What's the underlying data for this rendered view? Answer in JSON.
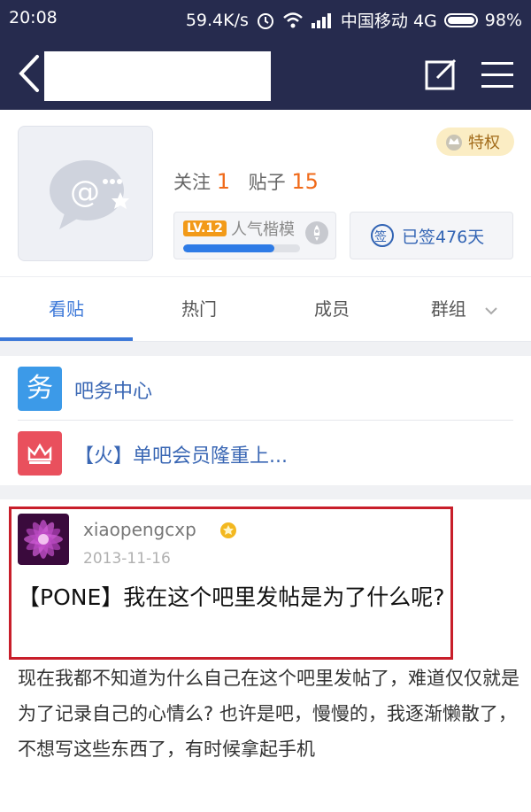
{
  "status_bar": {
    "time": "20:08",
    "network_speed": "59.4K/s",
    "carrier": "中国移动 4G",
    "battery": "98%"
  },
  "nav": {
    "back_icon": "chevron-left-icon",
    "edit_icon": "edit-icon",
    "menu_icon": "menu-icon"
  },
  "header": {
    "privilege_label": "特权",
    "follow_label": "关注",
    "follow_count": "1",
    "posts_label": "贴子",
    "posts_count": "15",
    "level_badge": "LV.12",
    "level_title": "人气楷模",
    "level_progress": 0.78,
    "signed_icon_text": "签",
    "signed_label": "已签476天"
  },
  "tabs": [
    {
      "label": "看贴",
      "active": true
    },
    {
      "label": "热门",
      "active": false
    },
    {
      "label": "成员",
      "active": false
    },
    {
      "label": "群组",
      "active": false
    }
  ],
  "notices": [
    {
      "icon_text": "务",
      "label": "吧务中心",
      "color": "#3c9ae8"
    },
    {
      "icon_text": "♛",
      "label": "【火】单吧会员隆重上...",
      "color": "#e9505d"
    }
  ],
  "post": {
    "author": "xiaopengcxp",
    "date": "2013-11-16",
    "title": "【PONE】我在这个吧里发帖是为了什么呢?",
    "body": "现在我都不知道为什么自己在这个吧里发帖了，难道仅仅就是为了记录自己的心情么? 也许是吧，慢慢的，我逐渐懒散了，不想写这些东西了，有时候拿起手机"
  },
  "colors": {
    "nav_bg": "#262b4e",
    "accent": "#3c78d8",
    "highlight_border": "#c81e2a"
  }
}
